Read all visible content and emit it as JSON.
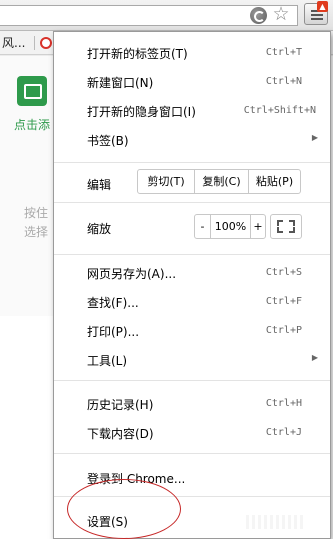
{
  "browser": {
    "bookmarks_bar_text": "风..."
  },
  "page": {
    "app_label": "点击添",
    "hint_line_1": "按住",
    "hint_line_2": "选择"
  },
  "menu": {
    "new_tab": {
      "label": "打开新的标签页(T)",
      "accel": "Ctrl+T"
    },
    "new_window": {
      "label": "新建窗口(N)",
      "accel": "Ctrl+N"
    },
    "new_incognito": {
      "label": "打开新的隐身窗口(I)",
      "accel": "Ctrl+Shift+N"
    },
    "bookmarks": {
      "label": "书签(B)"
    },
    "edit": {
      "label": "编辑",
      "cut": "剪切(T)",
      "copy": "复制(C)",
      "paste": "粘贴(P)"
    },
    "zoom": {
      "label": "缩放",
      "minus": "-",
      "value": "100%",
      "plus": "+"
    },
    "save_page": {
      "label": "网页另存为(A)...",
      "accel": "Ctrl+S"
    },
    "find": {
      "label": "查找(F)...",
      "accel": "Ctrl+F"
    },
    "print": {
      "label": "打印(P)...",
      "accel": "Ctrl+P"
    },
    "tools": {
      "label": "工具(L)"
    },
    "history": {
      "label": "历史记录(H)",
      "accel": "Ctrl+H"
    },
    "downloads": {
      "label": "下载内容(D)",
      "accel": "Ctrl+J"
    },
    "signin": {
      "label": "登录到 Chrome..."
    },
    "settings": {
      "label": "设置(S)"
    }
  },
  "colors": {
    "annotation": "#c62828",
    "app_accent": "#2e9a4b"
  }
}
